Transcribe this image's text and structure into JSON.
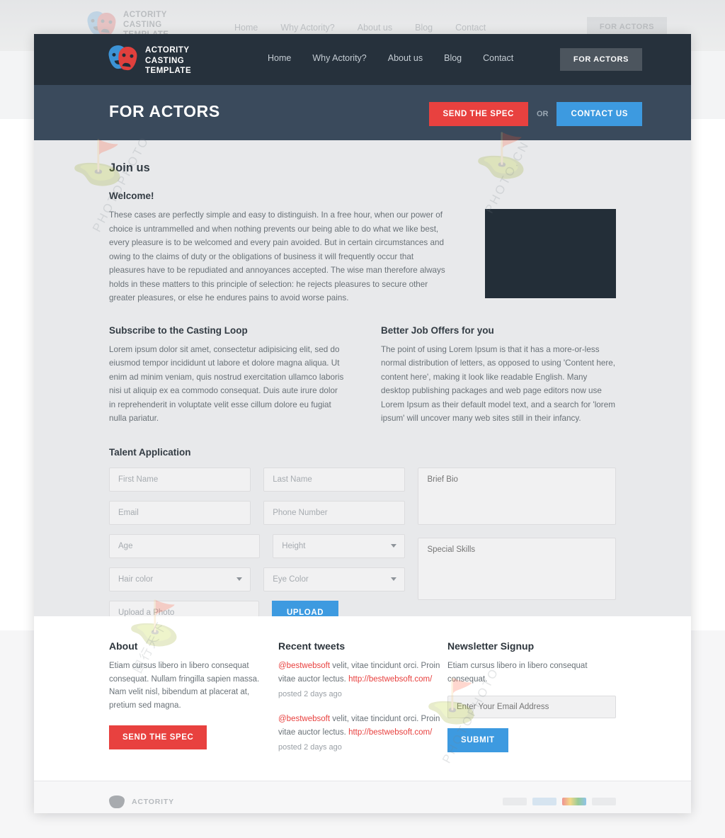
{
  "brand": {
    "logo_icon": "theater-masks-icon",
    "name_line1": "ACTORITY",
    "name_line2": "CASTING",
    "name_line3": "TEMPLATE",
    "short_name": "ACTORITY"
  },
  "header": {
    "nav": [
      {
        "label": "Home"
      },
      {
        "label": "Why Actority?"
      },
      {
        "label": "About us"
      },
      {
        "label": "Blog"
      },
      {
        "label": "Contact"
      }
    ],
    "cta_label": "FOR ACTORS",
    "bg_color": "#26313c"
  },
  "banner": {
    "title": "FOR ACTORS",
    "send_spec_label": "SEND THE SPEC",
    "or_label": "OR",
    "contact_label": "CONTACT US",
    "bg_color": "#3a4a5c",
    "red": "#e8413f",
    "blue": "#3d9ae0"
  },
  "main": {
    "page_heading": "Join us",
    "welcome": {
      "title": "Welcome!",
      "text": "These cases are perfectly simple and easy to distinguish. In a free hour, when our power of choice is untrammelled and when nothing prevents our being able to do what we like best, every pleasure is to be welcomed and every pain avoided. But in certain circumstances and owing to the claims of duty or the obligations of business it will frequently occur that pleasures have to be repudiated and annoyances accepted. The wise man therefore always holds in these matters to this principle of selection: he rejects pleasures to secure other greater pleasures, or else he endures pains to avoid worse pains."
    },
    "video_placeholder_color": "#232e38",
    "col_left": {
      "title": "Subscribe to the Casting Loop",
      "text": "Lorem ipsum dolor sit amet, consectetur adipisicing elit, sed do eiusmod tempor incididunt ut labore et dolore magna aliqua. Ut enim ad minim veniam, quis nostrud exercitation ullamco laboris nisi ut aliquip ex ea commodo consequat. Duis aute irure dolor in reprehenderit in voluptate velit esse cillum dolore eu fugiat nulla pariatur."
    },
    "col_right": {
      "title": "Better Job Offers for you",
      "text": " The point of using Lorem Ipsum is that it has a more-or-less normal distribution of letters, as opposed to using 'Content here, content here', making it look like readable English. Many desktop publishing packages and web page editors now use Lorem Ipsum as their default model text, and a search for 'lorem ipsum' will uncover many web sites still in their infancy."
    }
  },
  "form": {
    "title": "Talent Application",
    "first_name_placeholder": "First Name",
    "last_name_placeholder": "Last Name",
    "email_placeholder": "Email",
    "phone_placeholder": "Phone Number",
    "age_placeholder": "Age",
    "height_placeholder": "Height",
    "hair_color_placeholder": "Hair color",
    "eye_color_placeholder": "Eye Color",
    "upload_photo_placeholder": "Upload a Photo",
    "brief_bio_placeholder": "Brief Bio",
    "special_skills_placeholder": "Special Skills",
    "upload_label": "UPLOAD",
    "submit_label": "SUBMIT"
  },
  "footer": {
    "about": {
      "title": "About",
      "text": "Etiam cursus libero in libero consequat consequat. Nullam fringilla sapien massa. Nam velit nisl, bibendum at placerat at, pretium sed magna.",
      "button_label": "SEND THE SPEC"
    },
    "tweets": {
      "title": "Recent tweets",
      "items": [
        {
          "handle": "@bestwebsoft",
          "text": " velit, vitae tincidunt orci. Proin vitae auctor lectus. ",
          "link": "http://bestwebsoft.com/",
          "date": "posted 2 days ago"
        },
        {
          "handle": "@bestwebsoft",
          "text": " velit, vitae tincidunt orci. Proin vitae auctor lectus. ",
          "link": "http://bestwebsoft.com/",
          "date": "posted 2 days ago"
        }
      ]
    },
    "newsletter": {
      "title": "Newsletter Signup",
      "text": "Etiam cursus libero in libero consequat consequat.",
      "email_placeholder": "Enter Your Email Address",
      "submit_label": "SUBMIT"
    }
  },
  "watermark": {
    "text_a": "PHOTOPHOTO",
    "text_b": "图行天下",
    "text_c": "PHOTO.CN"
  }
}
